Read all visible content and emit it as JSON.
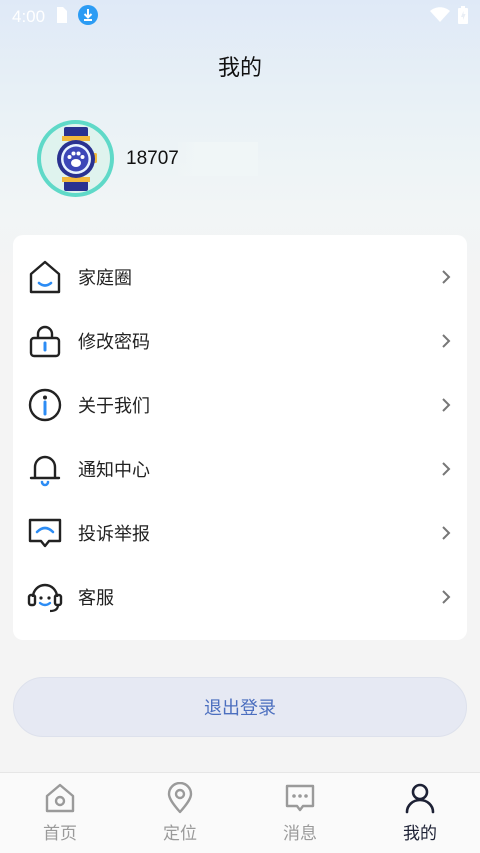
{
  "status_bar": {
    "time": "4:00"
  },
  "header": {
    "title": "我的"
  },
  "profile": {
    "phone": "18707"
  },
  "menu": {
    "items": [
      {
        "label": "家庭圈",
        "icon": "home-icon"
      },
      {
        "label": "修改密码",
        "icon": "lock-icon"
      },
      {
        "label": "关于我们",
        "icon": "info-icon"
      },
      {
        "label": "通知中心",
        "icon": "bell-icon"
      },
      {
        "label": "投诉举报",
        "icon": "report-icon"
      },
      {
        "label": "客服",
        "icon": "headset-icon"
      }
    ]
  },
  "logout": {
    "label": "退出登录"
  },
  "tabs": [
    {
      "label": "首页",
      "icon": "home-tab-icon",
      "active": false
    },
    {
      "label": "定位",
      "icon": "location-icon",
      "active": false
    },
    {
      "label": "消息",
      "icon": "message-icon",
      "active": false
    },
    {
      "label": "我的",
      "icon": "user-icon",
      "active": true
    }
  ],
  "colors": {
    "accent": "#4c6fbf",
    "icon_blue": "#2c8cf4",
    "avatar_ring": "#5fd9c8"
  }
}
